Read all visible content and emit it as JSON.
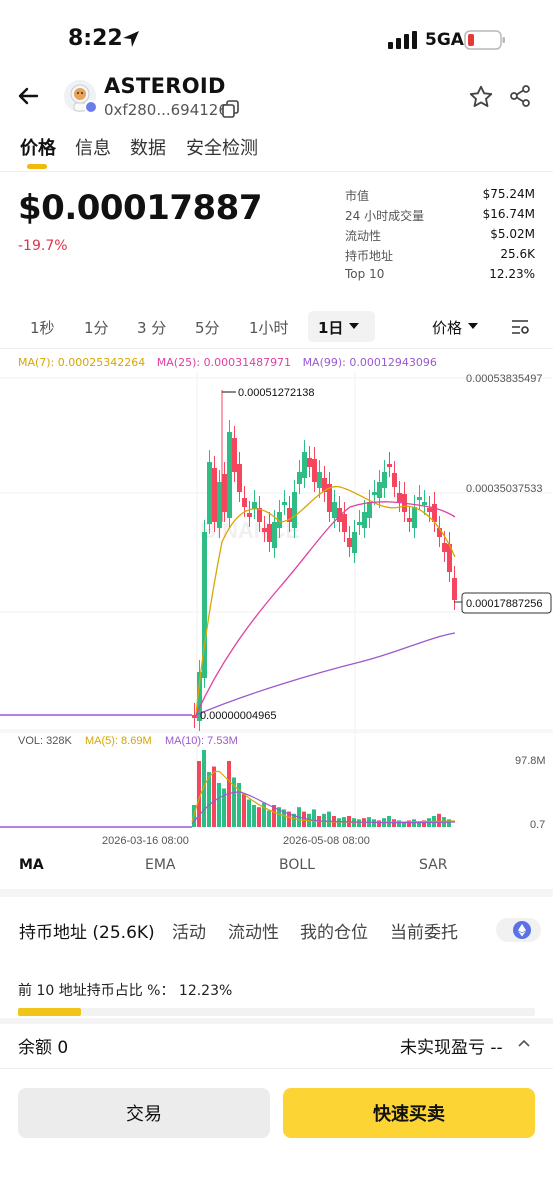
{
  "status": {
    "time": "8:22",
    "network": "5GA"
  },
  "token": {
    "name": "ASTEROID",
    "address": "0xf280...694126"
  },
  "tabs": [
    "价格",
    "信息",
    "数据",
    "安全检测"
  ],
  "price": {
    "value": "$0.00017887",
    "change": "-19.7%"
  },
  "stats": [
    {
      "label": "市值",
      "value": "$75.24M"
    },
    {
      "label": "24 小时成交量",
      "value": "$16.74M"
    },
    {
      "label": "流动性",
      "value": "$5.02M"
    },
    {
      "label": "持币地址",
      "value": "25.6K"
    },
    {
      "label": "Top 10",
      "value": "12.23%"
    }
  ],
  "intervals": [
    "1秒",
    "1分",
    "3 分",
    "5分",
    "1小时",
    "1日"
  ],
  "active_interval": "1日",
  "price_select": "价格",
  "ma": {
    "ma7": "MA(7): 0.00025342264",
    "ma25": "MA(25): 0.00031487971",
    "ma99": "MA(99): 0.00012943096"
  },
  "chart_data": {
    "type": "candlestick",
    "y_ticks": [
      "0.00053835497",
      "0.00035037533"
    ],
    "current_price_label": "0.00017887256",
    "high_label": "0.00051272138",
    "low_label": "0.00000004965",
    "x_labels": [
      "2026-03-16 08:00",
      "2026-05-08 08:00"
    ],
    "watermark": "BINANCE",
    "volume": {
      "vol": "VOL: 328K",
      "ma5": "MA(5): 8.69M",
      "ma10": "MA(10): 7.53M",
      "top_tick": "97.8M",
      "bottom_tick": "0.7"
    }
  },
  "indicators": [
    "MA",
    "EMA",
    "BOLL",
    "SAR"
  ],
  "holder_tabs": [
    "持币地址 (25.6K)",
    "活动",
    "流动性",
    "我的仓位",
    "当前委托"
  ],
  "top10_text": "前 10 地址持币占比 %：  12.23%",
  "top10_fraction": 0.1223,
  "balance_text": "余额 0",
  "pnl_text": "未实现盈亏 --",
  "buttons": {
    "trade": "交易",
    "quick": "快速买卖"
  },
  "colors": {
    "up": "#2ebd85",
    "down": "#f6465d",
    "accent": "#fcd535",
    "ma7": "#d9a600",
    "ma25": "#e040a0",
    "ma99": "#9b59d0"
  }
}
